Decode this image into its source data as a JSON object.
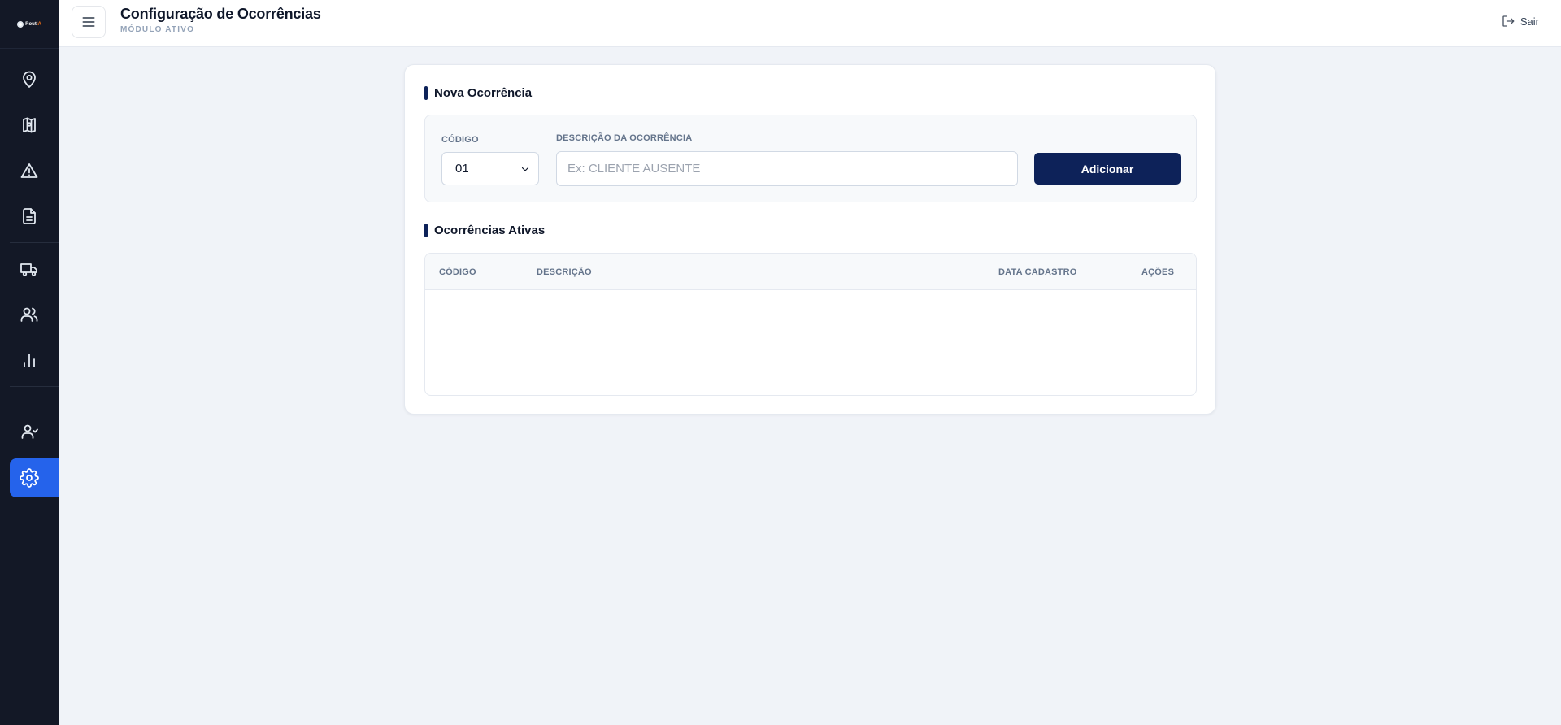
{
  "header": {
    "title": "Configuração de Ocorrências",
    "subtitle": "MÓDULO ATIVO",
    "logout_label": "Sair"
  },
  "sidebar": {
    "logo_text": "Rout",
    "logo_accent": "IA",
    "items": [
      {
        "icon": "map-pin-icon",
        "active": false
      },
      {
        "icon": "map-icon",
        "active": false
      },
      {
        "icon": "alert-triangle-icon",
        "active": false
      },
      {
        "icon": "document-icon",
        "active": false
      },
      {
        "icon": "truck-icon",
        "active": false
      },
      {
        "icon": "users-icon",
        "active": false
      },
      {
        "icon": "bar-chart-icon",
        "active": false
      },
      {
        "icon": "user-check-icon",
        "active": false
      },
      {
        "icon": "settings-icon",
        "active": true
      }
    ],
    "active_color": "#2563eb",
    "background": "#131826"
  },
  "new_occurrence": {
    "title": "Nova Ocorrência",
    "code_label": "CÓDIGO",
    "code_value": "01",
    "description_label": "DESCRIÇÃO DA OCORRÊNCIA",
    "description_placeholder": "Ex: CLIENTE AUSENTE",
    "description_value": "",
    "add_button": "Adicionar"
  },
  "active_occurrences": {
    "title": "Ocorrências Ativas",
    "columns": [
      "CÓDIGO",
      "DESCRIÇÃO",
      "DATA CADASTRO",
      "AÇÕES"
    ],
    "rows": []
  },
  "colors": {
    "primary": "#0d2259",
    "background": "#f0f3f8"
  }
}
